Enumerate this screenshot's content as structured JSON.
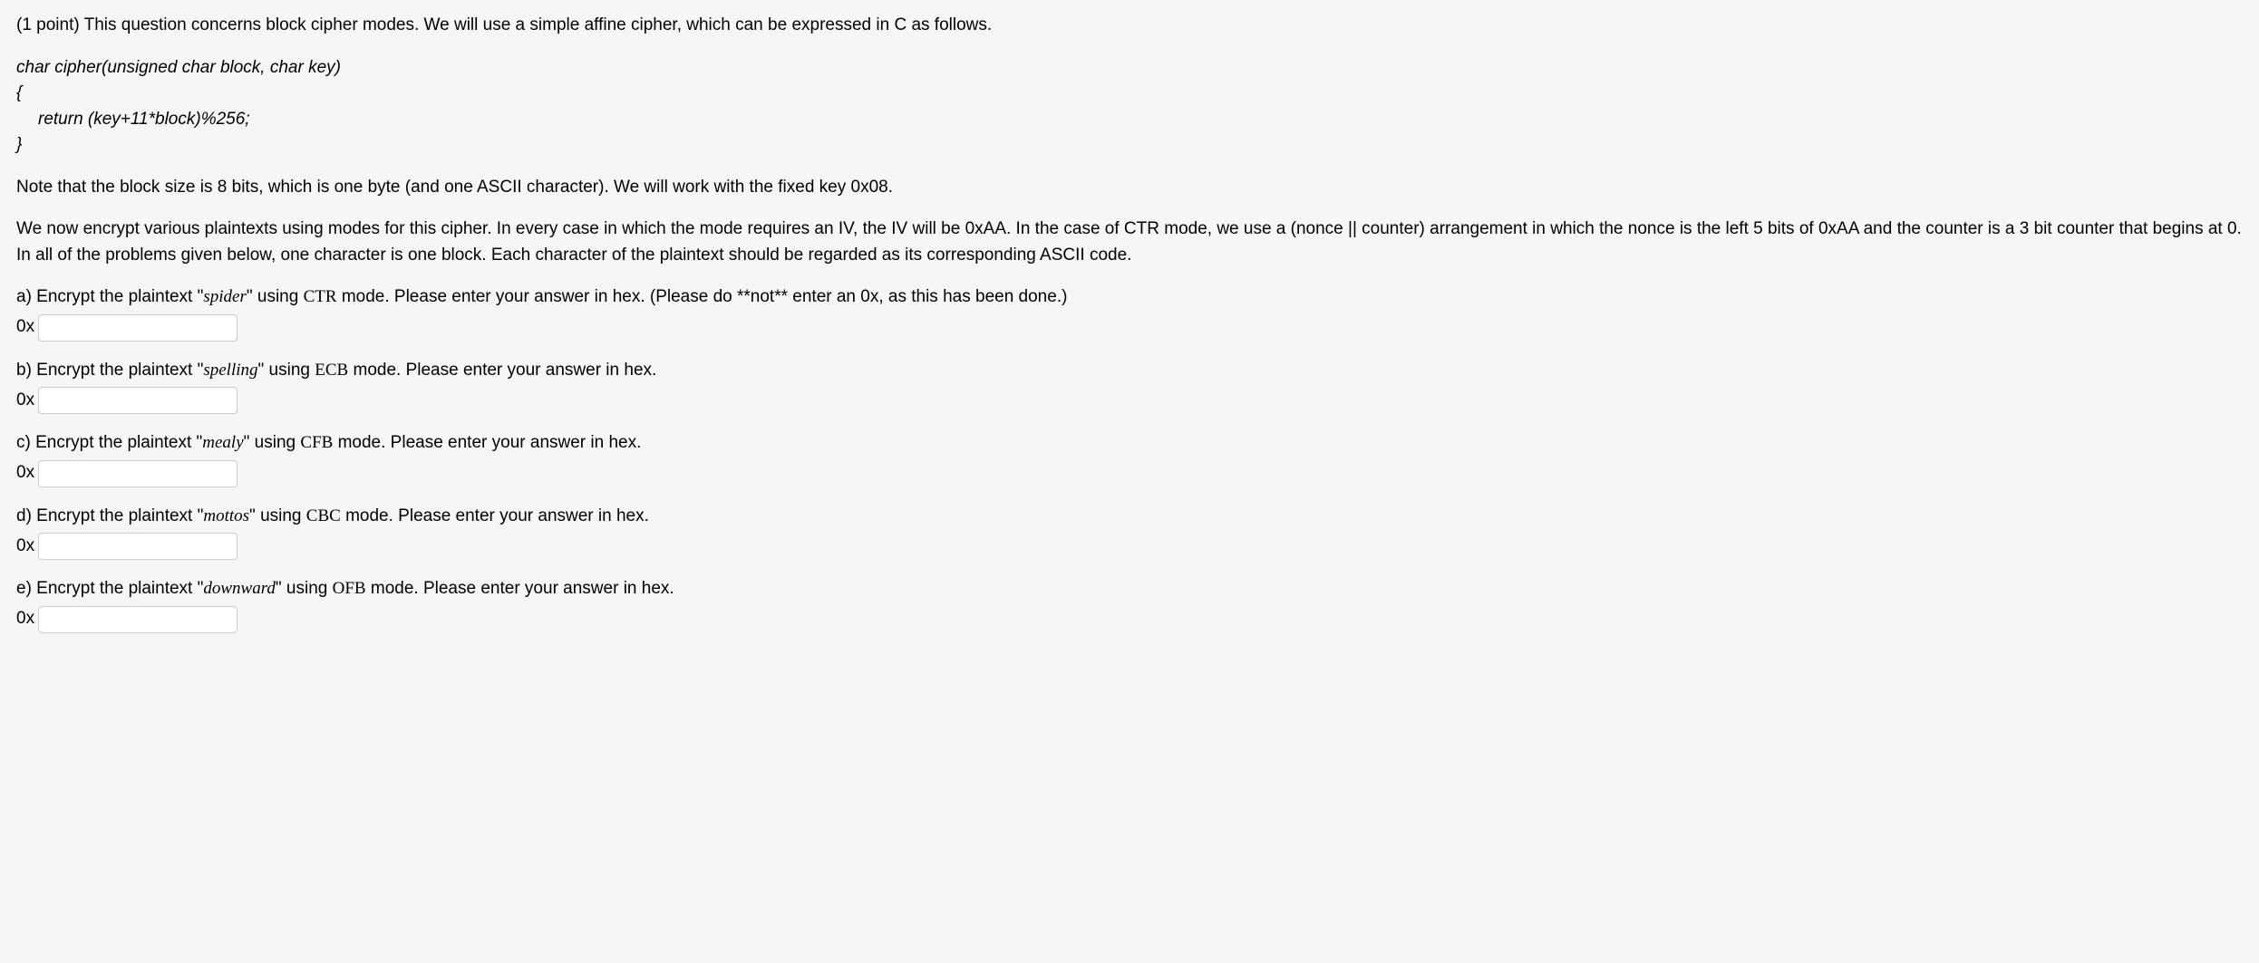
{
  "points": "(1 point)",
  "intro_rest": " This question concerns block cipher modes. We will use a simple affine cipher, which can be expressed in C as follows.",
  "code": {
    "sig": "char cipher(unsigned char block, char key)",
    "open": "{",
    "body": "return (key+11*block)%256;",
    "close": "}"
  },
  "note": "Note that the block size is 8 bits, which is one byte (and one ASCII character). We will work with the fixed key 0x08.",
  "description": "We now encrypt various plaintexts using modes for this cipher. In every case in which the mode requires an IV, the IV will be 0xAA. In the case of CTR mode, we use a (nonce || counter) arrangement in which the nonce is the left 5 bits of 0xAA and the counter is a 3 bit counter that begins at 0. In all of the problems given below, one character is one block. Each character of the plaintext should be regarded as its corresponding ASCII code.",
  "hex_prefix": "0x",
  "subs": {
    "a": {
      "label": "a)",
      "pre": " Encrypt the plaintext \"",
      "word": "spider",
      "mid": "\" using ",
      "mode": "CTR",
      "post": " mode. Please enter your answer in hex. (Please do **not** enter an 0x, as this has been done.)",
      "value": ""
    },
    "b": {
      "label": "b)",
      "pre": " Encrypt the plaintext \"",
      "word": "spelling",
      "mid": "\" using ",
      "mode": "ECB",
      "post": " mode. Please enter your answer in hex.",
      "value": ""
    },
    "c": {
      "label": "c)",
      "pre": " Encrypt the plaintext \"",
      "word": "mealy",
      "mid": "\" using ",
      "mode": "CFB",
      "post": " mode. Please enter your answer in hex.",
      "value": ""
    },
    "d": {
      "label": "d)",
      "pre": " Encrypt the plaintext \"",
      "word": "mottos",
      "mid": "\" using ",
      "mode": "CBC",
      "post": " mode. Please enter your answer in hex.",
      "value": ""
    },
    "e": {
      "label": "e)",
      "pre": " Encrypt the plaintext \"",
      "word": "downward",
      "mid": "\" using ",
      "mode": "OFB",
      "post": " mode. Please enter your answer in hex.",
      "value": ""
    }
  }
}
